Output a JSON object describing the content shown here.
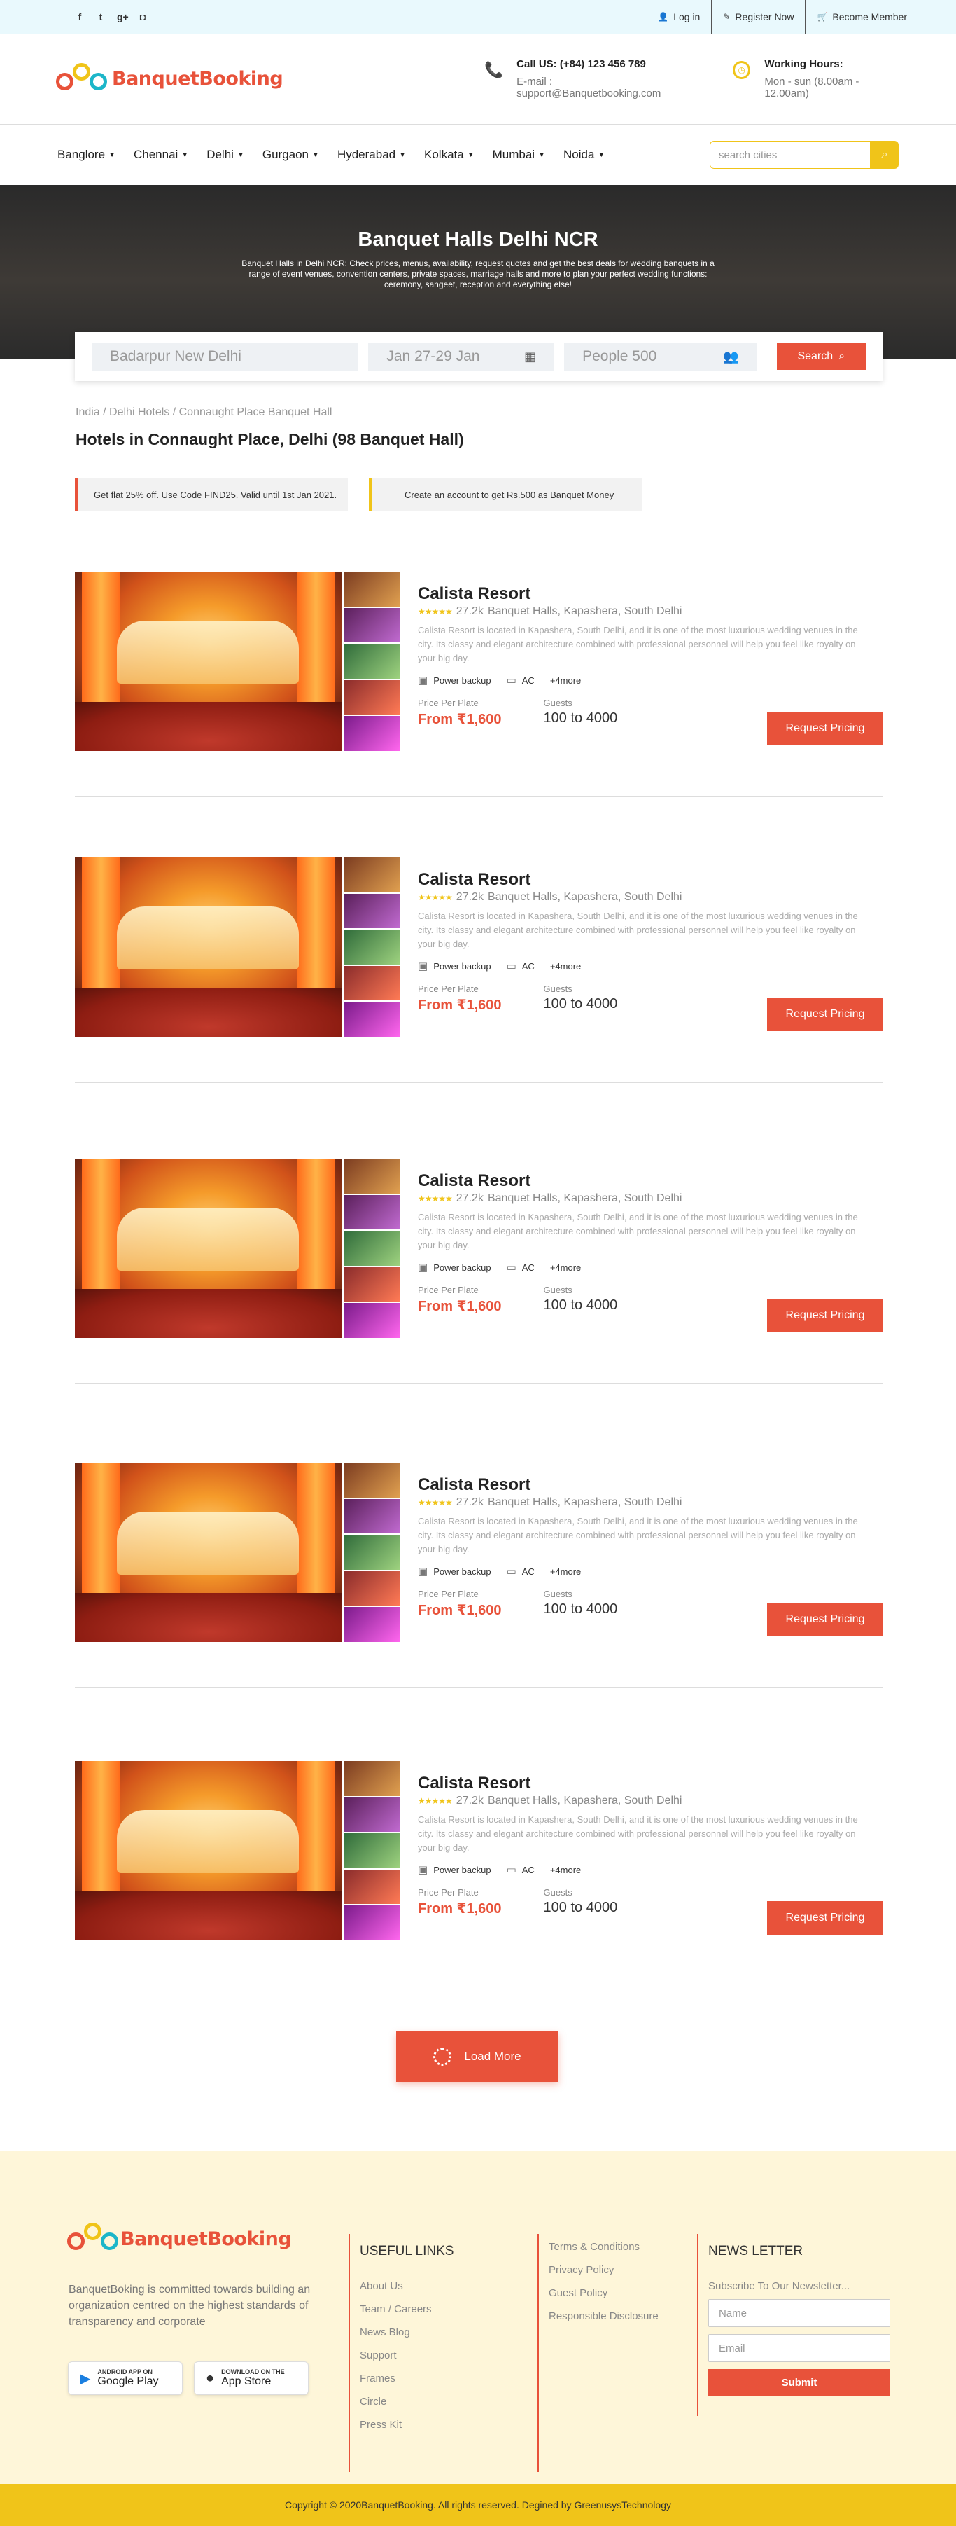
{
  "topbar": {
    "social": [
      {
        "icon": "facebook-icon",
        "glyph": "f"
      },
      {
        "icon": "twitter-icon",
        "glyph": "t"
      },
      {
        "icon": "google-plus-icon",
        "glyph": "g+"
      },
      {
        "icon": "instagram-icon",
        "glyph": "◘"
      }
    ],
    "login": "Log in",
    "register": "Register Now",
    "become_member": "Become Member"
  },
  "header": {
    "logo_text": "BanquetBooking",
    "call_title": "Call US: (+84) 123 456 789",
    "call_sub": "E-mail : support@Banquetbooking.com",
    "hours_title": "Working Hours:",
    "hours_sub": "Mon - sun (8.00am - 12.00am)"
  },
  "nav": {
    "cities": [
      "Banglore",
      "Chennai",
      "Delhi",
      "Gurgaon",
      "Hyderabad",
      "Kolkata",
      "Mumbai",
      "Noida"
    ],
    "search_placeholder": "search cities"
  },
  "hero": {
    "title": "Banquet Halls Delhi NCR",
    "text": "Banquet Halls in Delhi NCR: Check prices, menus, availability, request quotes and get the best deals for wedding banquets in a range of event venues, convention centers, private spaces, marriage halls and more to plan your perfect wedding functions: ceremony, sangeet, reception and everything else!"
  },
  "search": {
    "location": "Badarpur New Delhi",
    "dates": "Jan 27-29 Jan",
    "people": "People 500",
    "button": "Search"
  },
  "breadcrumb": "India / Delhi Hotels / Connaught Place Banquet Hall",
  "page_title": "Hotels in Connaught Place, Delhi (98 Banquet Hall)",
  "offers": [
    "Get flat 25% off. Use Code FIND25. Valid until 1st Jan 2021.",
    "Create an account to get Rs.500 as Banquet Money"
  ],
  "listing": {
    "name": "Calista Resort",
    "rating_stars": "★★★★★",
    "reviews": "27.2k",
    "location": "Banquet Halls, Kapashera, South Delhi",
    "description": "Calista Resort is located in Kapashera, South Delhi, and it is one of the most luxurious wedding venues in the city. Its classy and elegant architecture combined with professional personnel will help you feel like royalty on your big day.",
    "amenity1": "Power backup",
    "amenity2": "AC",
    "more": "+4more",
    "price_label": "Price Per Plate",
    "price_value": "From ₹1,600",
    "guests_label": "Guests",
    "guests_value": "100 to 4000",
    "cta": "Request Pricing"
  },
  "load_more": "Load More",
  "footer": {
    "logo_text": "BanquetBooking",
    "about": "BanquetBoking is committed towards building an organization centred on the highest standards of transparency and corporate",
    "google_small": "ANDROID APP ON",
    "google_big": "Google Play",
    "apple_small": "DOWNLOAD ON THE",
    "apple_big": "App Store",
    "useful_title": "USEFUL LINKS",
    "useful_links": [
      "About Us",
      "Team / Careers",
      "News Blog",
      "Support",
      "Frames",
      "Circle",
      "Press Kit"
    ],
    "legal_links": [
      "Terms & Conditions",
      "Privacy Policy",
      "Guest Policy",
      "Responsible Disclosure"
    ],
    "newsletter_title": "NEWS LETTER",
    "newsletter_sub": "Subscribe To Our Newsletter...",
    "name_placeholder": "Name",
    "email_placeholder": "Email",
    "submit": "Submit",
    "copyright": "Copyright © 2020BanquetBooking. All rights reserved. Degined by GreenusysTechnology"
  },
  "colors": {
    "accent": "#e8523a",
    "yellow": "#f0c419",
    "teal": "#1cb6c9",
    "footer_bg": "#fef6d9"
  }
}
